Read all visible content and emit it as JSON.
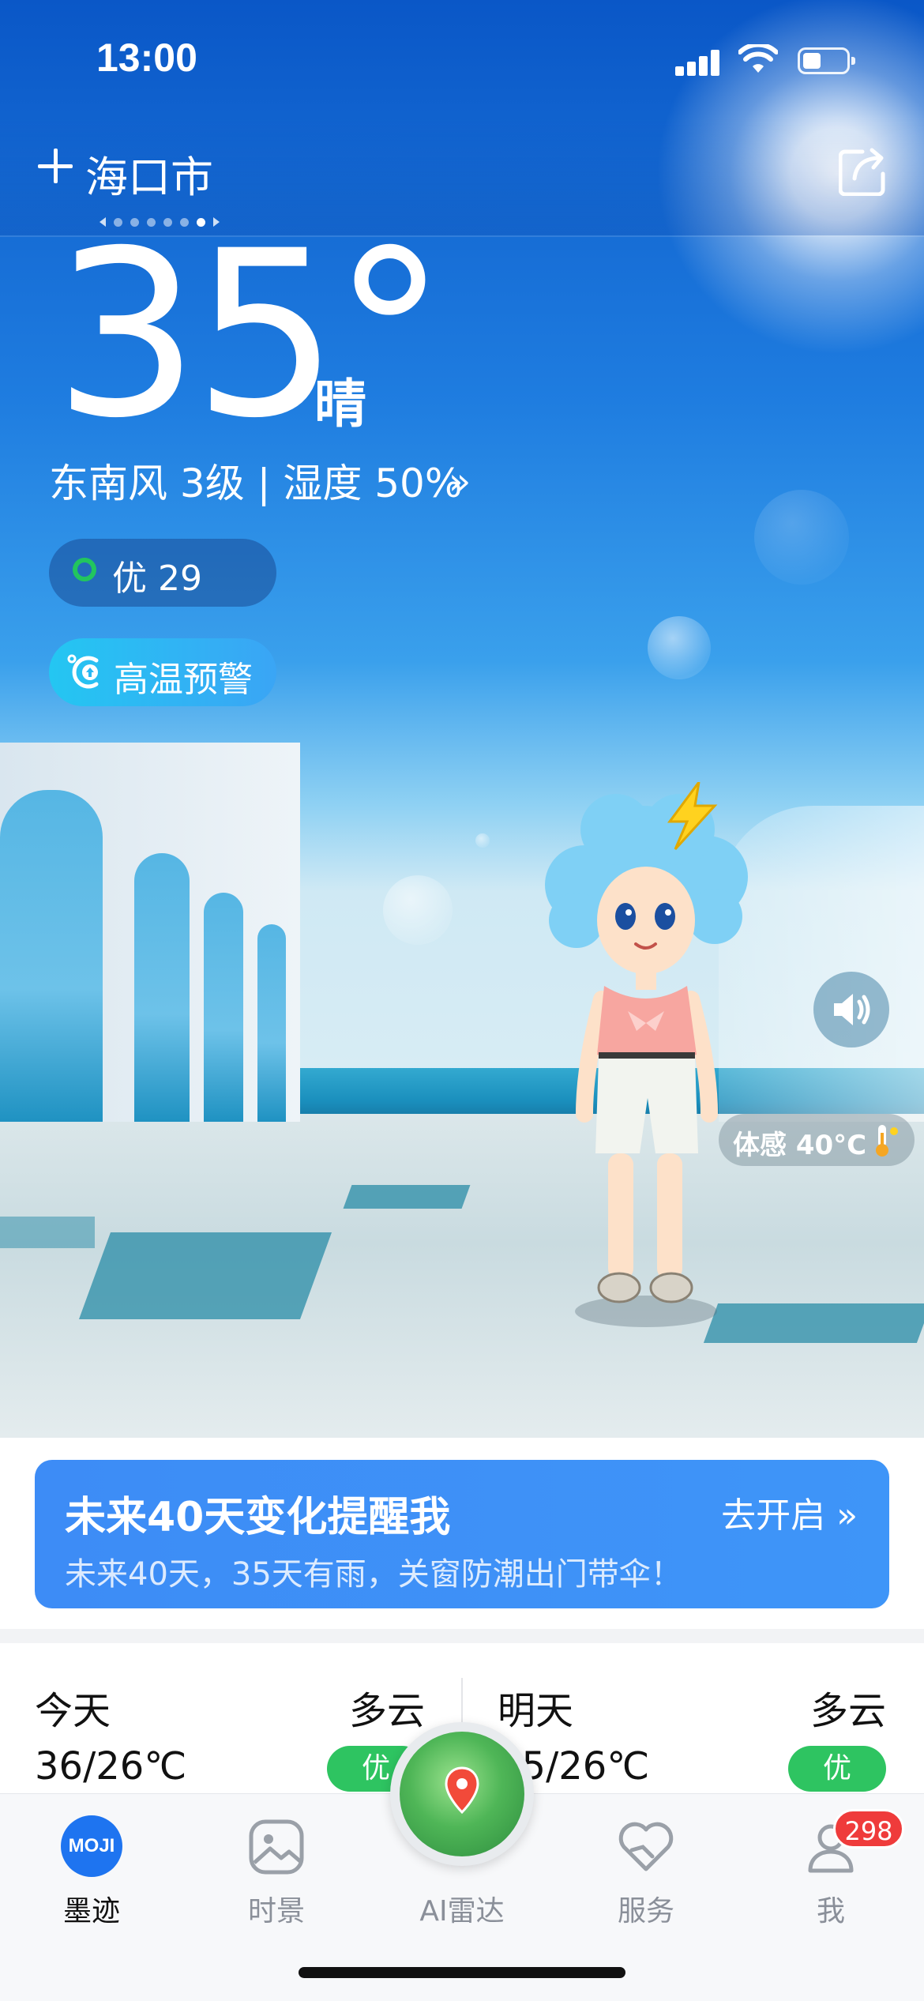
{
  "status_bar": {
    "time": "13:00"
  },
  "header": {
    "city": "海口市"
  },
  "current": {
    "temperature": "35°",
    "condition": "晴",
    "wind_humidity": "东南风 3级 | 湿度 50%",
    "more_arrow": "»",
    "aqi": "优 29",
    "warning": "高温预警",
    "feels_like": "体感 40°C"
  },
  "banner": {
    "title": "未来40天变化提醒我",
    "subtitle": "未来40天，35天有雨，关窗防潮出门带伞！",
    "action": "去开启 »"
  },
  "forecast": [
    {
      "day": "今天",
      "condition": "多云",
      "range": "36/26℃",
      "aqi": "优"
    },
    {
      "day": "明天",
      "condition": "多云",
      "range": "35/26℃",
      "aqi": "优"
    }
  ],
  "tabs": [
    {
      "label": "墨迹",
      "logo": "MOJI"
    },
    {
      "label": "时景"
    },
    {
      "label": "AI雷达"
    },
    {
      "label": "服务"
    },
    {
      "label": "我"
    }
  ],
  "notification_count": "298",
  "colors": {
    "accent": "#3d8cf6",
    "aqi_good": "#2ec461",
    "badge": "#ef3b3b"
  }
}
